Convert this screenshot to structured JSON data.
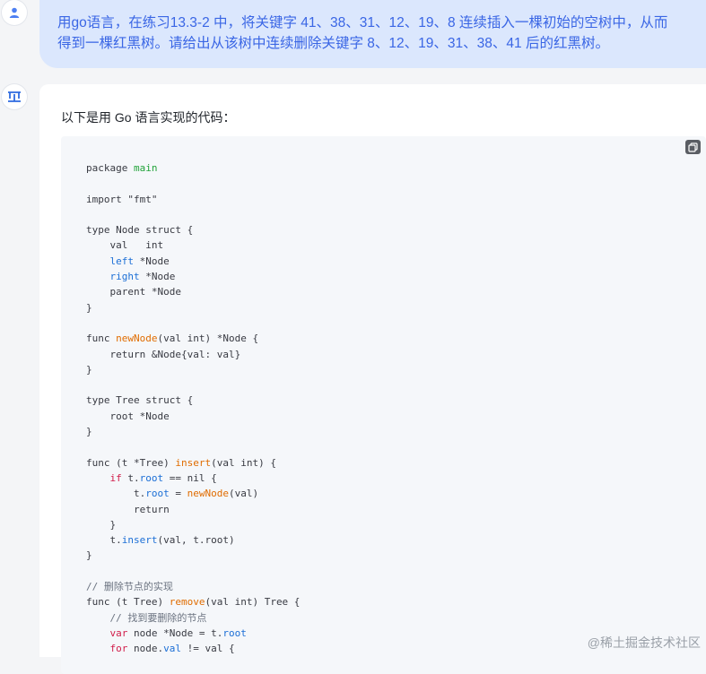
{
  "user_message": {
    "line1": "用go语言，在练习13.3-2 中，将关键字 41、38、31、12、19、8 连续插入一棵初始的空树中，从而",
    "line2": "得到一棵红黑树。请给出从该树中连续删除关键字 8、12、19、31、38、41 后的红黑树。"
  },
  "answer": {
    "intro": "以下是用 Go 语言实现的代码："
  },
  "code": [
    {
      "segs": [
        {
          "t": "package "
        },
        {
          "t": "main",
          "c": "kw-green"
        }
      ]
    },
    {
      "segs": []
    },
    {
      "segs": [
        {
          "t": "import "
        },
        {
          "t": "\"fmt\""
        }
      ]
    },
    {
      "segs": []
    },
    {
      "segs": [
        {
          "t": "type Node struct {"
        }
      ]
    },
    {
      "segs": [
        {
          "t": "    val   int"
        }
      ]
    },
    {
      "segs": [
        {
          "t": "    "
        },
        {
          "t": "left",
          "c": "kw-blue"
        },
        {
          "t": " *Node"
        }
      ]
    },
    {
      "segs": [
        {
          "t": "    "
        },
        {
          "t": "right",
          "c": "kw-blue"
        },
        {
          "t": " *Node"
        }
      ]
    },
    {
      "segs": [
        {
          "t": "    parent *Node"
        }
      ]
    },
    {
      "segs": [
        {
          "t": "}"
        }
      ]
    },
    {
      "segs": []
    },
    {
      "segs": [
        {
          "t": "func "
        },
        {
          "t": "newNode",
          "c": "kw-orange"
        },
        {
          "t": "(val int) *Node {"
        }
      ]
    },
    {
      "segs": [
        {
          "t": "    return &Node{val: val}"
        }
      ]
    },
    {
      "segs": [
        {
          "t": "}"
        }
      ]
    },
    {
      "segs": []
    },
    {
      "segs": [
        {
          "t": "type Tree struct {"
        }
      ]
    },
    {
      "segs": [
        {
          "t": "    root *Node"
        }
      ]
    },
    {
      "segs": [
        {
          "t": "}"
        }
      ]
    },
    {
      "segs": []
    },
    {
      "segs": [
        {
          "t": "func (t *Tree) "
        },
        {
          "t": "insert",
          "c": "kw-orange"
        },
        {
          "t": "(val int) {"
        }
      ]
    },
    {
      "segs": [
        {
          "t": "    "
        },
        {
          "t": "if",
          "c": "kw-red"
        },
        {
          "t": " t."
        },
        {
          "t": "root",
          "c": "kw-blue"
        },
        {
          "t": " == nil {"
        }
      ]
    },
    {
      "segs": [
        {
          "t": "        t."
        },
        {
          "t": "root",
          "c": "kw-blue"
        },
        {
          "t": " = "
        },
        {
          "t": "newNode",
          "c": "kw-orange"
        },
        {
          "t": "(val)"
        }
      ]
    },
    {
      "segs": [
        {
          "t": "        return"
        }
      ]
    },
    {
      "segs": [
        {
          "t": "    }"
        }
      ]
    },
    {
      "segs": [
        {
          "t": "    t."
        },
        {
          "t": "insert",
          "c": "kw-blue"
        },
        {
          "t": "(val, t.root)"
        }
      ]
    },
    {
      "segs": [
        {
          "t": "}"
        }
      ]
    },
    {
      "segs": []
    },
    {
      "segs": [
        {
          "t": "// 删除节点的实现",
          "c": "comment"
        }
      ]
    },
    {
      "segs": [
        {
          "t": "func (t Tree) "
        },
        {
          "t": "remove",
          "c": "kw-orange"
        },
        {
          "t": "(val int) Tree {"
        }
      ]
    },
    {
      "segs": [
        {
          "t": "    "
        },
        {
          "t": "// 找到要删除的节点",
          "c": "comment"
        }
      ]
    },
    {
      "segs": [
        {
          "t": "    "
        },
        {
          "t": "var",
          "c": "kw-red"
        },
        {
          "t": " node *Node = t."
        },
        {
          "t": "root",
          "c": "kw-blue"
        }
      ]
    },
    {
      "segs": [
        {
          "t": "    "
        },
        {
          "t": "for",
          "c": "kw-red"
        },
        {
          "t": " node."
        },
        {
          "t": "val",
          "c": "kw-blue"
        },
        {
          "t": " != val {"
        }
      ]
    }
  ],
  "watermark": "@稀土掘金技术社区",
  "colors": {
    "user_bubble_bg": "#dbe7fd",
    "user_text": "#3a66e5",
    "code_bg": "#f5f7fa"
  },
  "icons": {
    "user_avatar": "user-icon",
    "ai_avatar": "ai-logo-icon",
    "copy": "copy-icon"
  }
}
